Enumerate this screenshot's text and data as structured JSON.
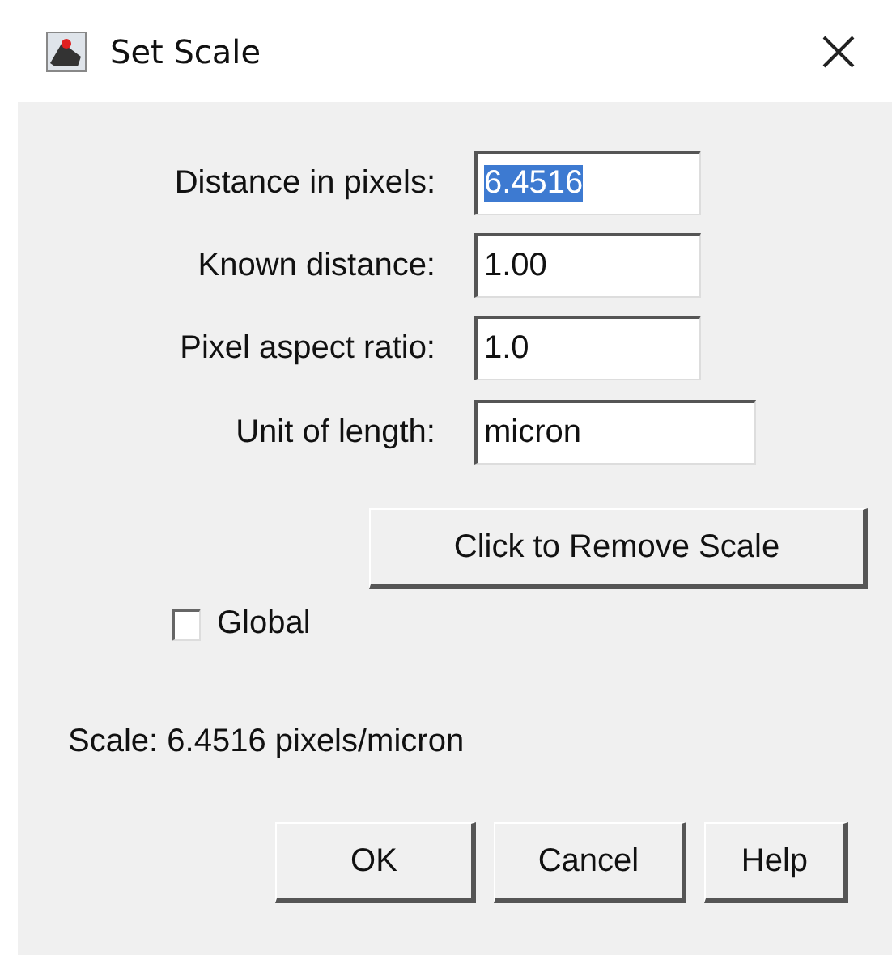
{
  "window": {
    "title": "Set Scale"
  },
  "fields": [
    {
      "label": "Distance in pixels:",
      "value": "6.4516",
      "highlighted": true
    },
    {
      "label": "Known distance:",
      "value": "1.00",
      "highlighted": false
    },
    {
      "label": "Pixel aspect ratio:",
      "value": "1.0",
      "highlighted": false
    },
    {
      "label": "Unit of length:",
      "value": "micron",
      "highlighted": false
    }
  ],
  "remove_button": "Click to Remove Scale",
  "global_checkbox": {
    "label": "Global",
    "checked": false
  },
  "scale_text": "Scale: 6.4516 pixels/micron",
  "buttons": [
    "OK",
    "Cancel",
    "Help"
  ]
}
